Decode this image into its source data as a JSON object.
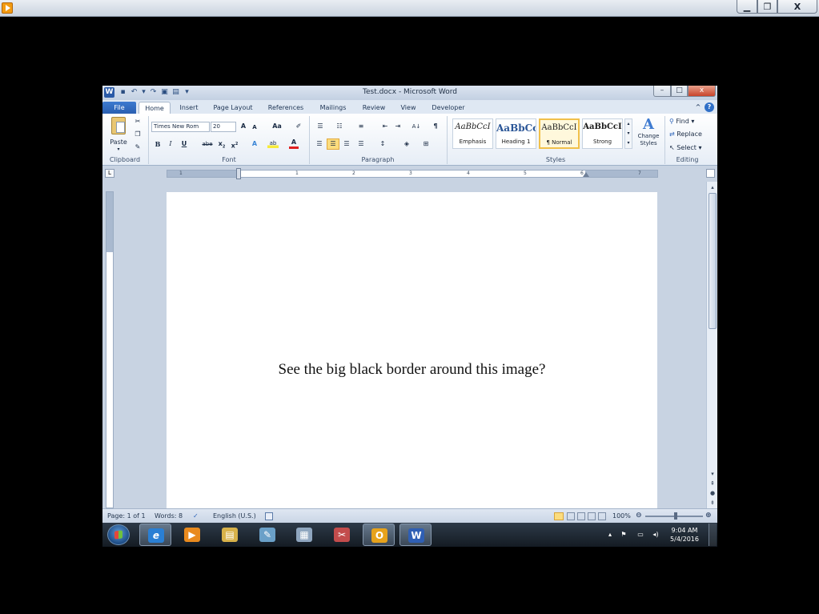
{
  "outer_window": {
    "controls": {
      "minimize": "▁",
      "maximize": "❐",
      "close": "X"
    }
  },
  "word": {
    "title": "Test.docx - Microsoft Word",
    "app_icon_letter": "W",
    "window_controls": {
      "minimize": "–",
      "maximize": "□",
      "close": "x"
    },
    "tabs": [
      "File",
      "Home",
      "Insert",
      "Page Layout",
      "References",
      "Mailings",
      "Review",
      "View",
      "Developer"
    ],
    "help": "?",
    "collapse": "^"
  },
  "ribbon": {
    "groups": {
      "clipboard": "Clipboard",
      "font": "Font",
      "paragraph": "Paragraph",
      "styles": "Styles",
      "editing": "Editing"
    },
    "clipboard": {
      "paste_label": "Paste"
    },
    "font": {
      "family_value": "Times New Rom",
      "size_value": "20",
      "grow": "A",
      "shrink": "A",
      "change_case": "Aa",
      "bold": "B",
      "italic": "I",
      "underline": "U",
      "strikethrough": "abe",
      "subscript": "x",
      "superscript": "x",
      "text_effects": "A",
      "highlight": "ab",
      "font_color": "A"
    },
    "paragraph": {
      "show_marks": "¶",
      "sort": "A↓"
    },
    "styles": [
      {
        "preview": "AaBbCcI",
        "name": "Emphasis"
      },
      {
        "preview": "AaBbCc",
        "name": "Heading 1"
      },
      {
        "preview": "AaBbCcI",
        "name": "¶ Normal"
      },
      {
        "preview": "AaBbCcI",
        "name": "Strong"
      }
    ],
    "change_styles": "Change Styles",
    "editing": {
      "find": "Find",
      "replace": "Replace",
      "select": "Select"
    }
  },
  "ruler": {
    "corner": "L",
    "numbers": [
      "1",
      "1",
      "2",
      "3",
      "4",
      "5",
      "6",
      "7"
    ]
  },
  "document": {
    "text": "See the big black border around this image?"
  },
  "status": {
    "page": "Page: 1 of 1",
    "words": "Words: 8",
    "language": "English (U.S.)",
    "zoom": "100%"
  },
  "taskbar": {
    "apps": [
      {
        "name": "internet-explorer",
        "glyph": "e",
        "color": "#2a7fd4"
      },
      {
        "name": "media-player",
        "glyph": "▶",
        "color": "#e98a1e"
      },
      {
        "name": "file-explorer",
        "glyph": "▤",
        "color": "#d8b24a"
      },
      {
        "name": "paint",
        "glyph": "✎",
        "color": "#6aa0c8"
      },
      {
        "name": "calculator",
        "glyph": "▦",
        "color": "#8fa6bf"
      },
      {
        "name": "snipping-tool",
        "glyph": "✂",
        "color": "#c34c4c"
      },
      {
        "name": "outlook",
        "glyph": "O",
        "color": "#e6a21c"
      },
      {
        "name": "word",
        "glyph": "W",
        "color": "#2f5fb4"
      }
    ],
    "time": "9:04 AM",
    "date": "5/4/2016"
  }
}
